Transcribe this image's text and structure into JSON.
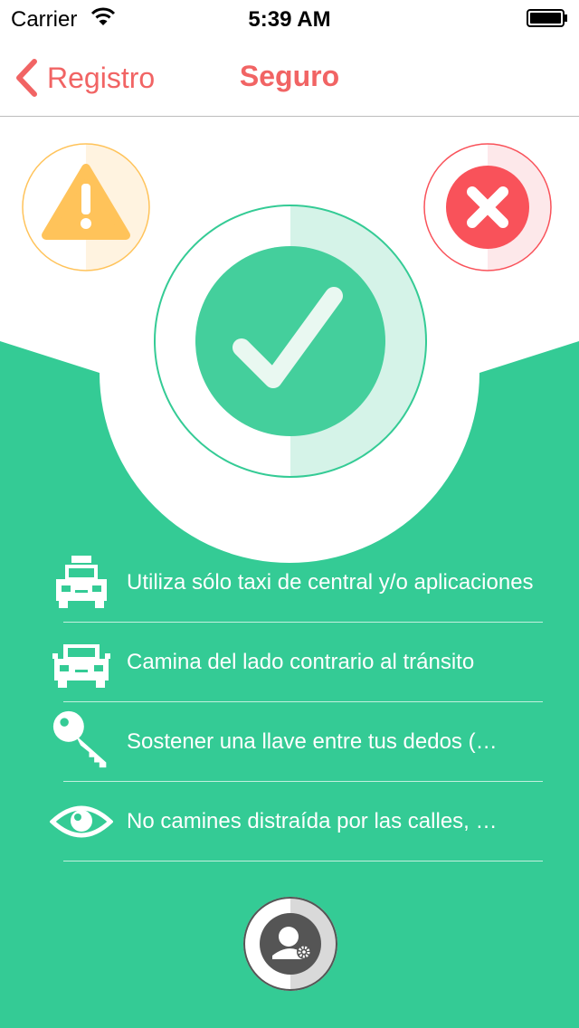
{
  "status_bar": {
    "carrier": "Carrier",
    "time": "5:39 AM"
  },
  "nav": {
    "back_label": "Registro",
    "title": "Seguro"
  },
  "colors": {
    "accent": "#f16464",
    "green": "#34cb95",
    "warning": "#ffc35a",
    "danger": "#f9525a"
  },
  "tips": [
    {
      "icon": "taxi-icon",
      "text": "Utiliza sólo taxi de central y/o aplicaciones"
    },
    {
      "icon": "car-icon",
      "text": "Camina del lado contrario al tránsito"
    },
    {
      "icon": "key-icon",
      "text": "Sostener una llave entre tus dedos (…"
    },
    {
      "icon": "eye-icon",
      "text": "No camines distraída por las calles, …"
    }
  ]
}
